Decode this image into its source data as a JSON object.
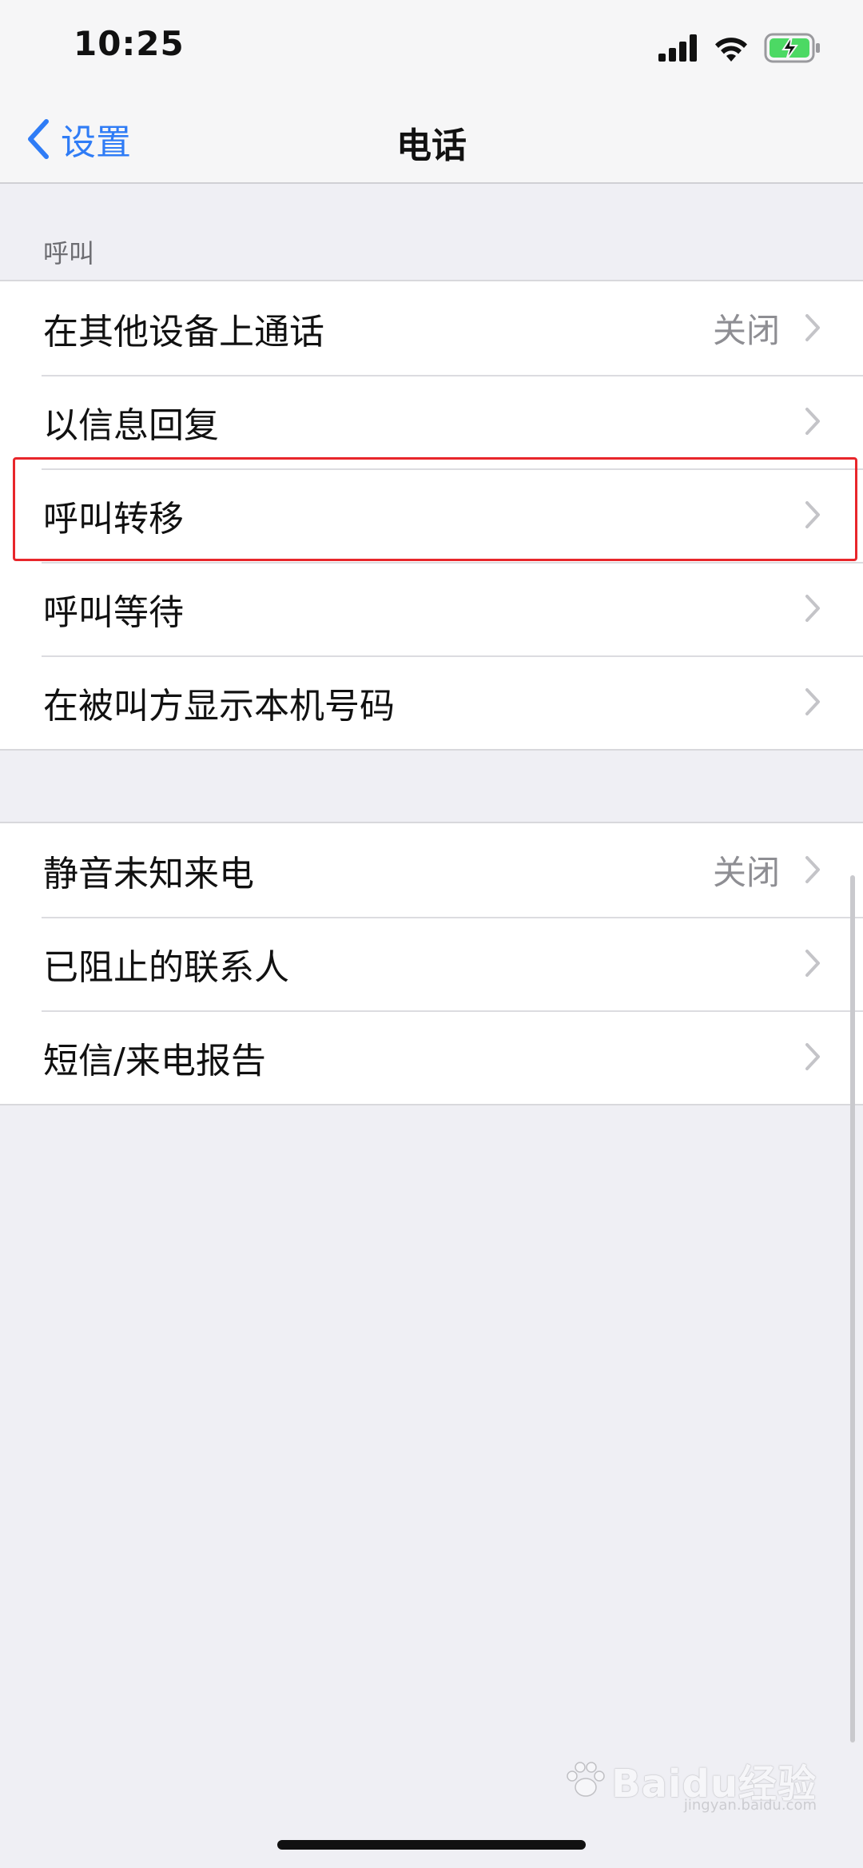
{
  "status_bar": {
    "time": "10:25",
    "signal_icon": "cellular-signal-icon",
    "wifi_icon": "wifi-icon",
    "battery_icon": "battery-charging-icon",
    "battery_color": "#4cd964"
  },
  "nav": {
    "back_label": "设置",
    "title": "电话",
    "accent_color": "#2f7cf6"
  },
  "section_calls": {
    "header": "呼叫",
    "items": [
      {
        "label": "在其他设备上通话",
        "value": "关闭"
      },
      {
        "label": "以信息回复",
        "value": ""
      },
      {
        "label": "呼叫转移",
        "value": "",
        "highlighted": true
      },
      {
        "label": "呼叫等待",
        "value": ""
      },
      {
        "label": "在被叫方显示本机号码",
        "value": ""
      }
    ]
  },
  "section_blocking": {
    "items": [
      {
        "label": "静音未知来电",
        "value": "关闭"
      },
      {
        "label": "已阻止的联系人",
        "value": ""
      },
      {
        "label": "短信/来电报告",
        "value": ""
      }
    ]
  },
  "watermark": {
    "logo": "Baidu经验",
    "sub": "jingyan.baidu.com"
  }
}
